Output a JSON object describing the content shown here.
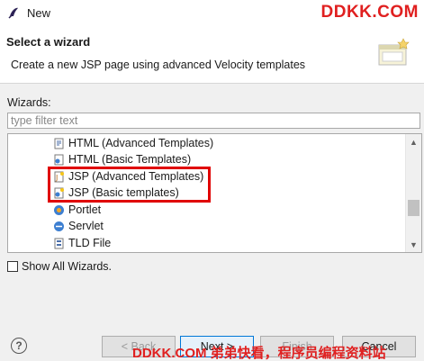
{
  "window": {
    "title": "New",
    "watermark_top": "DDKK.COM"
  },
  "header": {
    "title": "Select a wizard",
    "description": "Create a new JSP page using advanced Velocity templates"
  },
  "wizards": {
    "label": "Wizards:",
    "filter_placeholder": "type filter text",
    "items": [
      {
        "label": "HTML (Advanced Templates)",
        "icon": "html-file-icon"
      },
      {
        "label": "HTML (Basic Templates)",
        "icon": "html-file-icon"
      },
      {
        "label": "JSP (Advanced Templates)",
        "icon": "jsp-file-icon"
      },
      {
        "label": "JSP (Basic templates)",
        "icon": "jsp-file-icon"
      },
      {
        "label": "Portlet",
        "icon": "portlet-icon"
      },
      {
        "label": "Servlet",
        "icon": "servlet-icon"
      },
      {
        "label": "TLD File",
        "icon": "tld-file-icon"
      }
    ],
    "show_all_label": "Show All Wizards."
  },
  "buttons": {
    "help": "?",
    "back": "< Back",
    "next": "Next >",
    "finish": "Finish",
    "cancel": "Cancel"
  },
  "watermark_bottom": "DDKK.COM 弟弟快看，程序员编程资料站",
  "colors": {
    "highlight": "#e00000",
    "watermark": "#e02020",
    "focus_border": "#0078d7"
  }
}
